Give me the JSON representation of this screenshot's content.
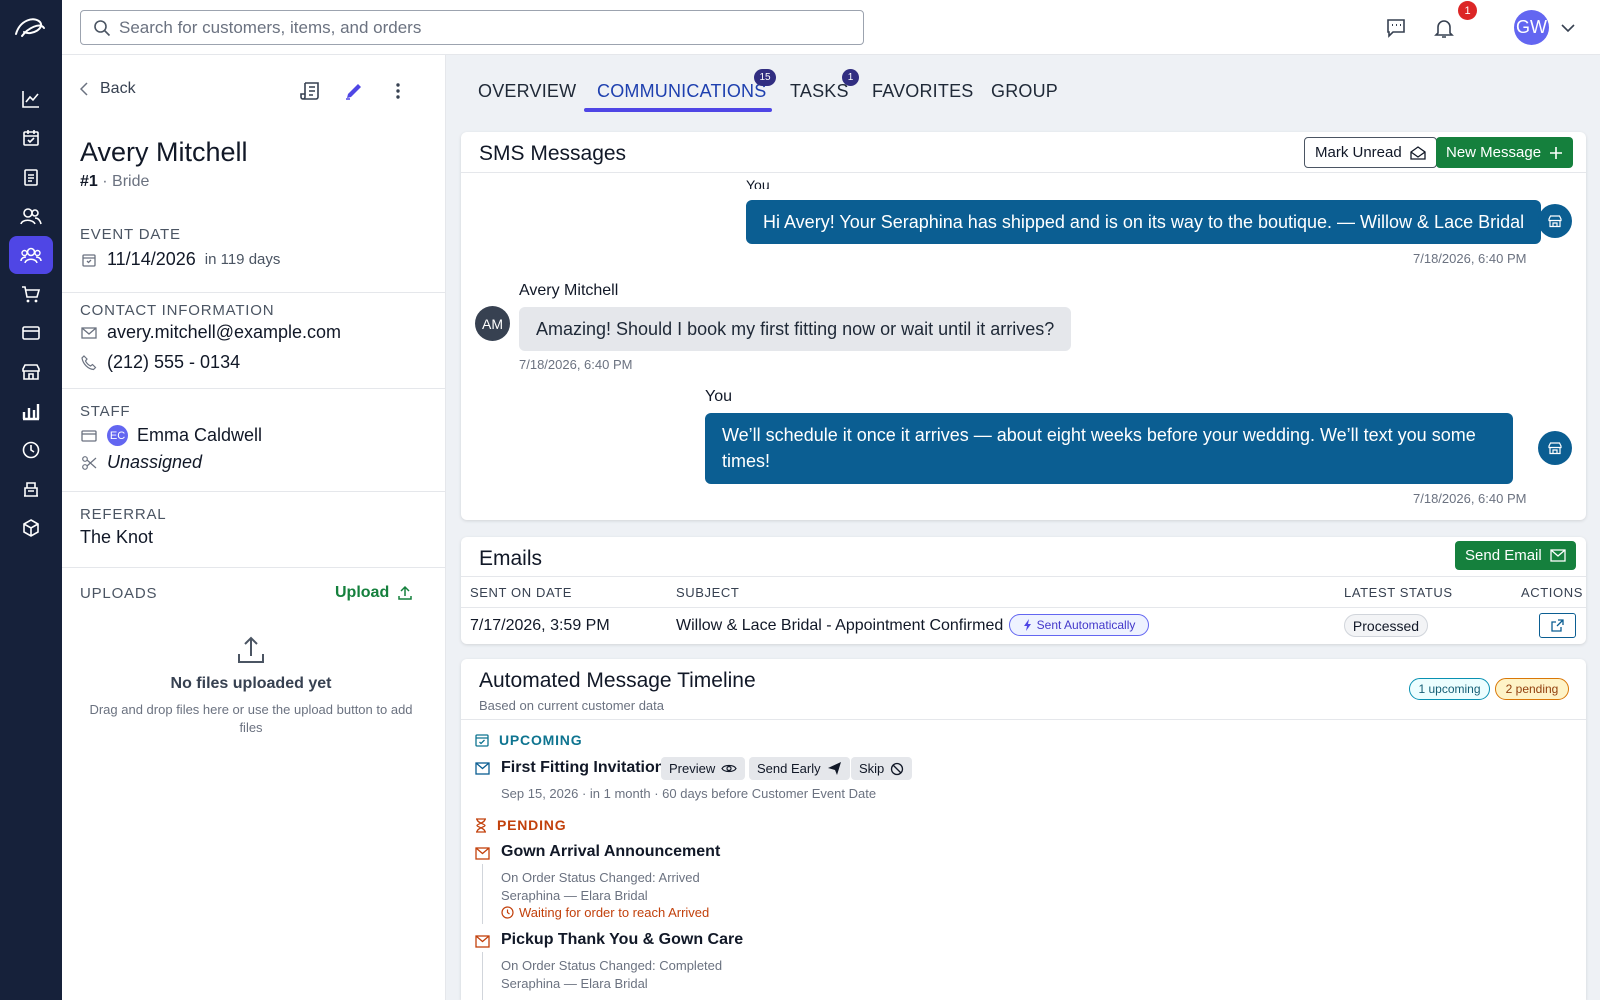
{
  "search": {
    "placeholder": "Search for customers, items, and orders"
  },
  "topbar": {
    "notifications_count": "1",
    "avatar_initials": "GW"
  },
  "nav": {
    "icons": [
      "analytics-icon",
      "calendar-icon",
      "clipboard-icon",
      "customers-icon",
      "customers-active-icon",
      "cart-icon",
      "card-icon",
      "store-icon",
      "bar-chart-icon",
      "history-icon",
      "register-icon",
      "package-icon"
    ],
    "active_index": 4
  },
  "customer": {
    "back_label": "Back",
    "name": "Avery Mitchell",
    "number": "#1",
    "role": "Bride",
    "event_date_label": "EVENT DATE",
    "event_date": "11/14/2026",
    "event_date_relative": "in 119 days",
    "contact_label": "CONTACT INFORMATION",
    "email": "avery.mitchell@example.com",
    "phone": "(212) 555 - 0134",
    "staff_label": "STAFF",
    "staff_initials": "EC",
    "staff_name": "Emma Caldwell",
    "staff_unassigned": "Unassigned",
    "referral_label": "REFERRAL",
    "referral": "The Knot",
    "uploads_label": "UPLOADS",
    "upload_link": "Upload",
    "no_files": "No files uploaded yet",
    "no_files_hint": "Drag and drop files here or use the upload button to add files"
  },
  "tabs": [
    {
      "label": "OVERVIEW"
    },
    {
      "label": "COMMUNICATIONS",
      "badge": "15"
    },
    {
      "label": "TASKS",
      "badge": "1"
    },
    {
      "label": "FAVORITES"
    },
    {
      "label": "GROUP"
    }
  ],
  "sms": {
    "title": "SMS Messages",
    "mark_unread": "Mark Unread",
    "new_message": "New Message",
    "messages": [
      {
        "sender": "You",
        "text": "Hi Avery! Your Seraphina has shipped and is on its way to the boutique. — Willow & Lace Bridal",
        "time": "7/18/2026, 6:40 PM"
      },
      {
        "sender": "Avery Mitchell",
        "initials": "AM",
        "text": "Amazing! Should I book my first fitting now or wait until it arrives?",
        "time": "7/18/2026, 6:40 PM"
      },
      {
        "sender": "You",
        "text": "We’ll schedule it once it arrives — about eight weeks before your wedding. We’ll text you some times!",
        "time": "7/18/2026, 6:40 PM"
      }
    ]
  },
  "emails": {
    "title": "Emails",
    "send_email": "Send Email",
    "columns": [
      "SENT ON DATE",
      "SUBJECT",
      "LATEST STATUS",
      "ACTIONS"
    ],
    "rows": [
      {
        "date": "7/17/2026, 3:59 PM",
        "subject": "Willow & Lace Bridal - Appointment Confirmed",
        "tag": "Sent Automatically",
        "status": "Processed"
      }
    ]
  },
  "timeline": {
    "title": "Automated Message Timeline",
    "subtitle": "Based on current customer data",
    "upcoming_badge": "1 upcoming",
    "pending_badge": "2 pending",
    "upcoming_label": "UPCOMING",
    "pending_label": "PENDING",
    "upcoming": [
      {
        "title": "First Fitting Invitation",
        "detail": "Sep 15, 2026 · in 1 month · 60 days before Customer Event Date",
        "actions": [
          "Preview",
          "Send Early",
          "Skip"
        ]
      }
    ],
    "pending": [
      {
        "title": "Gown Arrival Announcement",
        "trigger": "On Order Status Changed: Arrived",
        "item": "Seraphina — Elara Bridal",
        "waiting": "Waiting for order to reach Arrived"
      },
      {
        "title": "Pickup Thank You & Gown Care",
        "trigger": "On Order Status Changed: Completed",
        "item": "Seraphina — Elara Bridal"
      }
    ]
  },
  "colors": {
    "accent": "#4f46e5",
    "green": "#15803d",
    "bubble_out": "#0b5e92",
    "rail": "#16213a",
    "pending": "#c2410c",
    "upcoming": "#0e7490"
  }
}
